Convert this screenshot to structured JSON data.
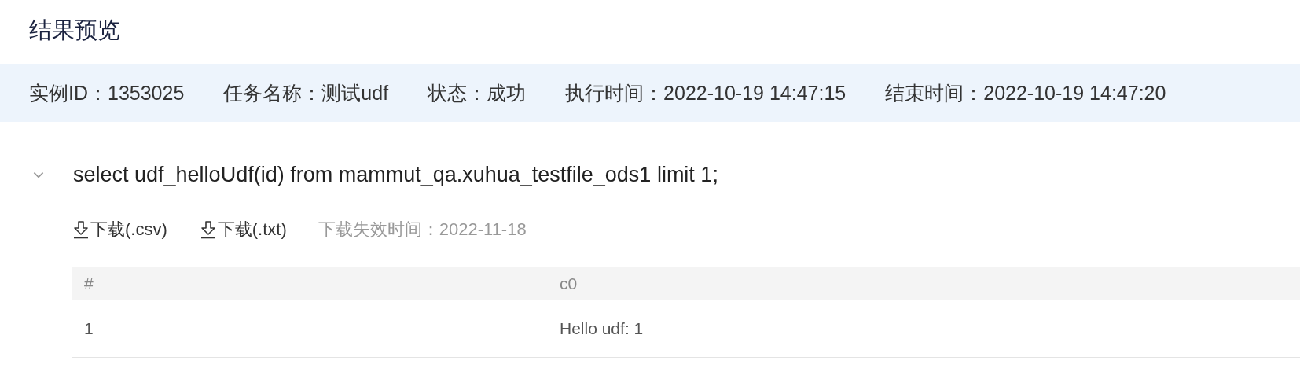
{
  "title": "结果预览",
  "info": [
    "实例ID：1353025",
    "任务名称：测试udf",
    "状态：成功",
    "执行时间：2022-10-19 14:47:15",
    "结束时间：2022-10-19 14:47:20"
  ],
  "query": {
    "text": "select udf_helloUdf(id) from mammut_qa.xuhua_testfile_ods1 limit 1;",
    "expanded": true
  },
  "downloads": [
    "下载(.csv)",
    "下载(.txt)"
  ],
  "expiry": "下载失效时间：2022-11-18",
  "table": {
    "columns": [
      "#",
      "c0"
    ],
    "rows": [
      [
        "1",
        "Hello udf: 1"
      ]
    ]
  }
}
